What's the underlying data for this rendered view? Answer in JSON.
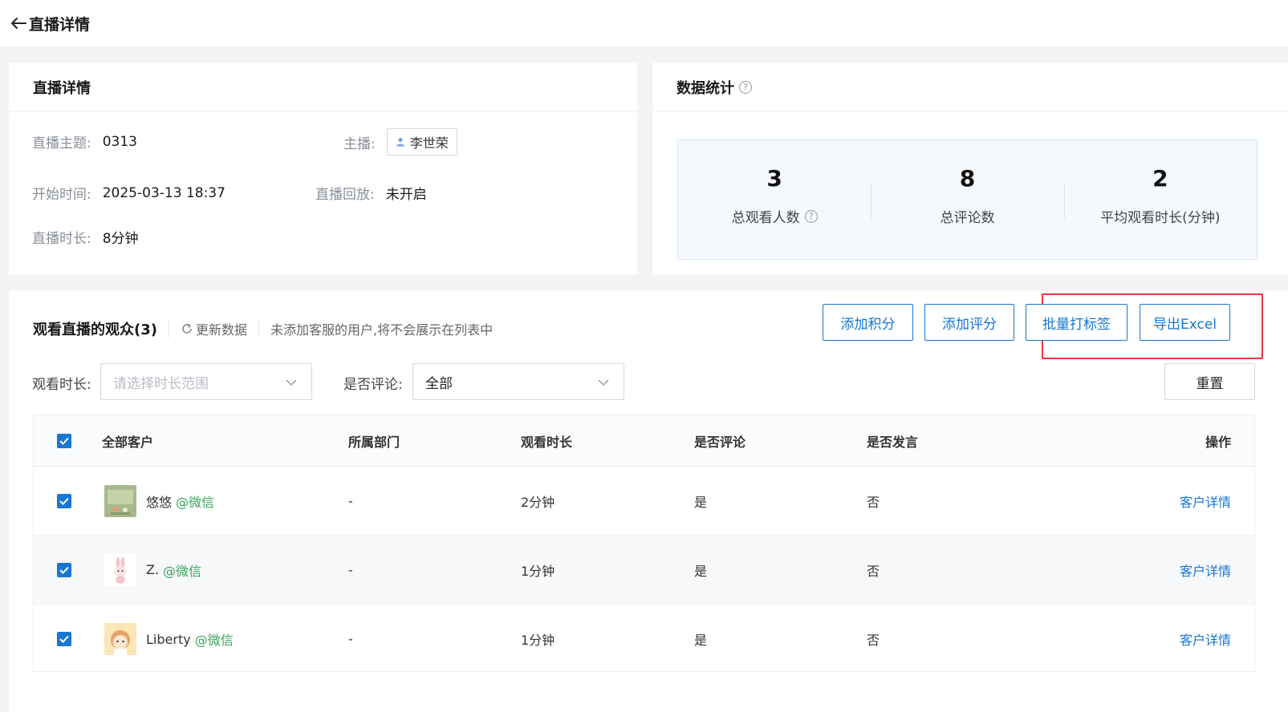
{
  "header": {
    "title": "直播详情"
  },
  "detail": {
    "title": "直播详情",
    "topic_label": "直播主题:",
    "topic": "0313",
    "host_label": "主播:",
    "host": "李世荣",
    "start_label": "开始时间:",
    "start": "2025-03-13 18:37",
    "replay_label": "直播回放:",
    "replay": "未开启",
    "duration_label": "直播时长:",
    "duration": "8分钟"
  },
  "stats": {
    "title": "数据统计",
    "items": [
      {
        "value": "3",
        "label": "总观看人数"
      },
      {
        "value": "8",
        "label": "总评论数"
      },
      {
        "value": "2",
        "label": "平均观看时长(分钟)"
      }
    ]
  },
  "audience": {
    "title": "观看直播的观众(3)",
    "refresh": "更新数据",
    "note": "未添加客服的用户,将不会展示在列表中",
    "buttons": {
      "add_points": "添加积分",
      "add_score": "添加评分",
      "batch_tag": "批量打标签",
      "export": "导出Excel"
    },
    "filters": {
      "duration_label": "观看时长:",
      "duration_placeholder": "请选择时长范围",
      "comment_label": "是否评论:",
      "comment_value": "全部",
      "reset": "重置"
    },
    "columns": [
      "全部客户",
      "所属部门",
      "观看时长",
      "是否评论",
      "是否发言",
      "操作"
    ],
    "rows": [
      {
        "name": "悠悠",
        "channel": "@微信",
        "dept": "-",
        "watch": "2分钟",
        "commented": "是",
        "spoke": "否",
        "action": "客户详情"
      },
      {
        "name": "Z.",
        "channel": "@微信",
        "dept": "-",
        "watch": "1分钟",
        "commented": "是",
        "spoke": "否",
        "action": "客户详情"
      },
      {
        "name": "Liberty",
        "channel": "@微信",
        "dept": "-",
        "watch": "1分钟",
        "commented": "是",
        "spoke": "否",
        "action": "客户详情"
      }
    ]
  },
  "colors": {
    "primary": "#1677d2",
    "highlight": "#e23b3b",
    "channel": "#3aa55a"
  }
}
